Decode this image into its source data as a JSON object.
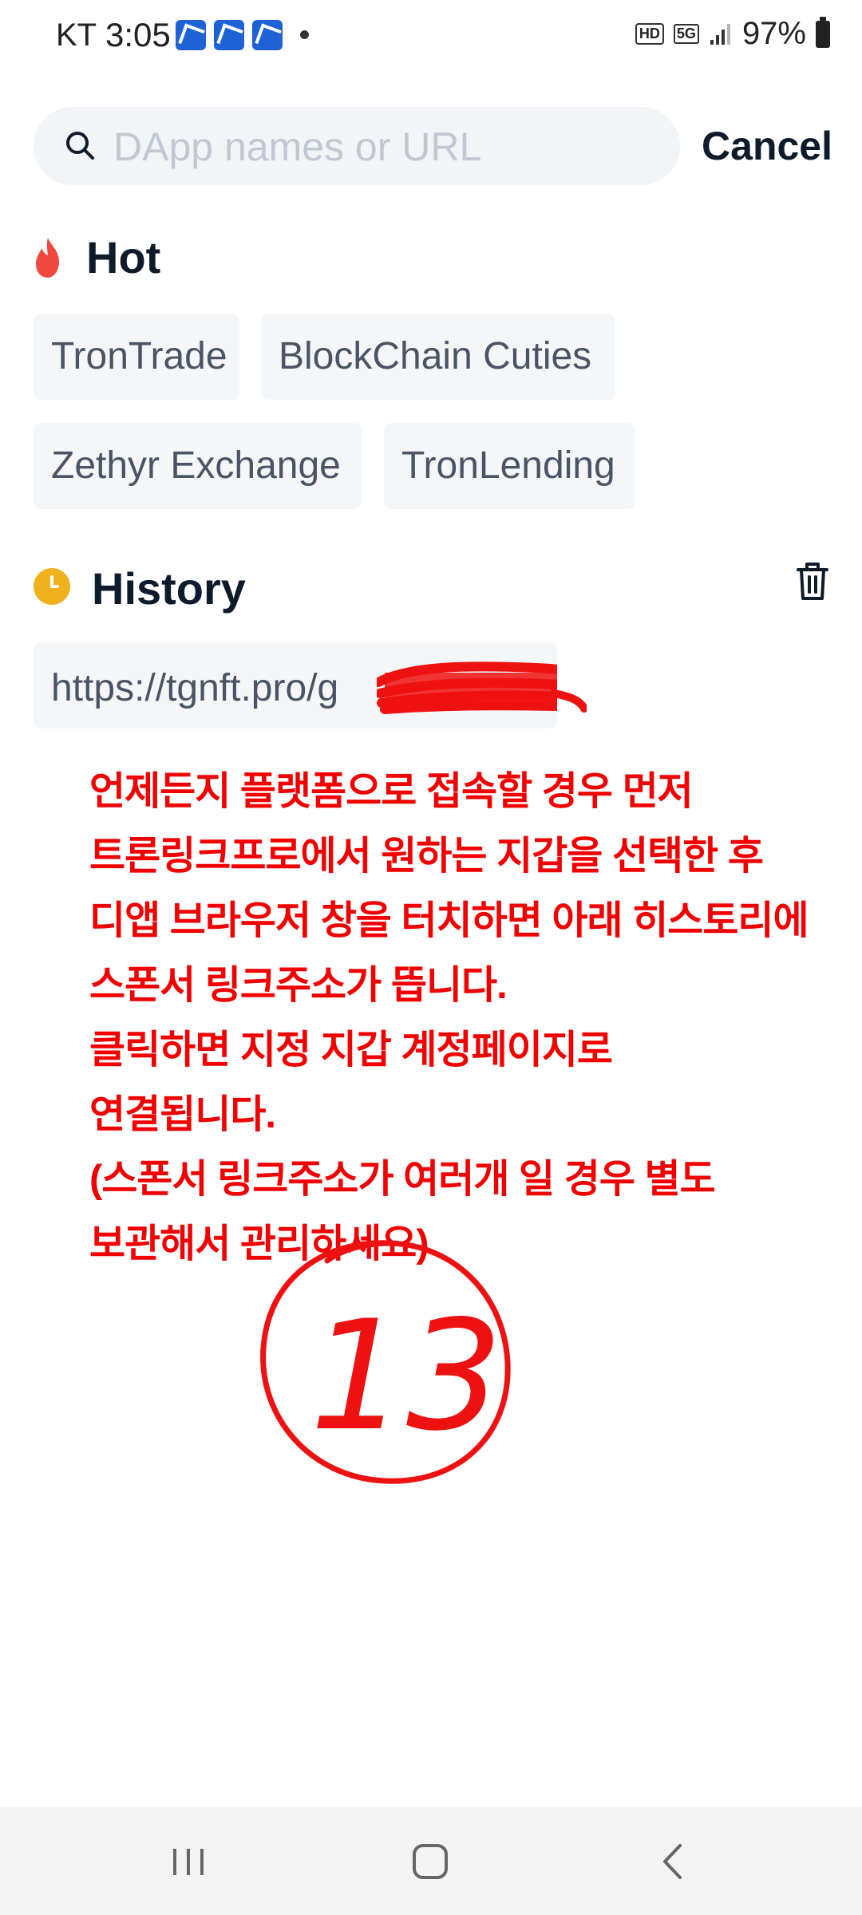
{
  "status_bar": {
    "carrier": "KT",
    "time": "3:05",
    "battery": "97%",
    "network": "5G",
    "hd": "HD"
  },
  "search": {
    "placeholder": "DApp names or URL",
    "value": "",
    "cancel_label": "Cancel"
  },
  "hot": {
    "title": "Hot",
    "items": [
      "TronTrade",
      "BlockChain Cuties",
      "Zethyr Exchange",
      "TronLending"
    ]
  },
  "history": {
    "title": "History",
    "items": [
      {
        "url": "https://tgnft.pro/g"
      }
    ]
  },
  "annotation": {
    "text": "언제든지 플랫폼으로 접속할 경우 먼저\n트론링크프로에서 원하는 지갑을 선택한 후\n디앱 브라우저 창을 터치하면 아래 히스토리에\n스폰서 링크주소가 뜹니다.\n클릭하면 지정 지갑 계정페이지로\n연결됩니다.\n(스폰서 링크주소가 여러개 일 경우 별도\n보관해서 관리하세요)",
    "circled_number": "13",
    "color": "#f20000"
  },
  "colors": {
    "chip_bg": "#f4f6f8",
    "search_bg": "#f2f4f7",
    "flame": "#f0483e",
    "clock": "#f0b11e"
  },
  "nav": {
    "recents_icon": "recents-icon",
    "home_icon": "home-icon",
    "back_icon": "back-icon"
  }
}
